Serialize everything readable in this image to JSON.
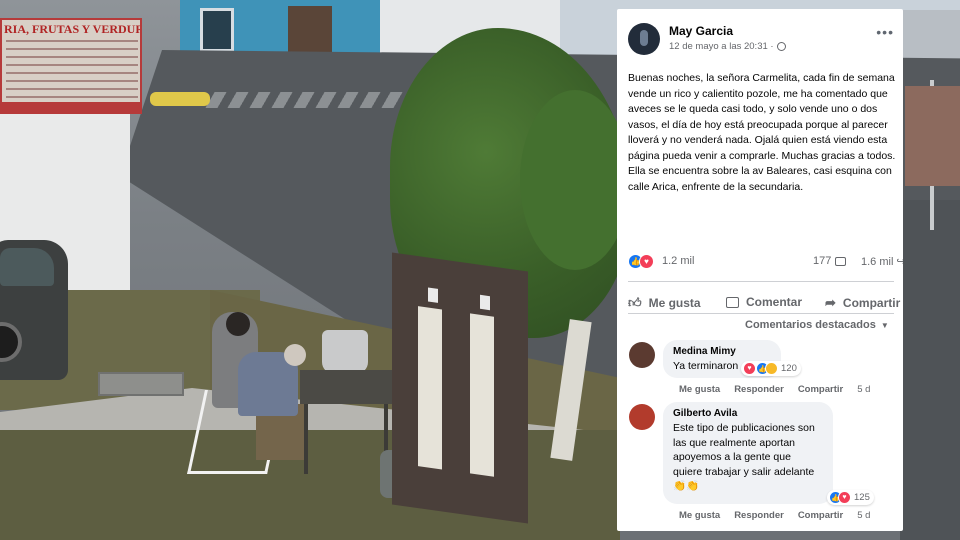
{
  "background": {
    "banner_title": "RIA, FRUTAS Y VERDURAS"
  },
  "post": {
    "author": "May Garcia",
    "date": "12 de mayo a las 20:31 ·",
    "privacy_icon": "globe-icon",
    "more_icon": "more-options-icon",
    "text": "Buenas noches, la señora Carmelita, cada fin de semana vende un rico y calientito pozole, me ha comentado que aveces se le queda casi todo, y solo vende uno o dos vasos, el día de hoy está preocupada porque al parecer lloverá y no venderá nada. Ojalá quien está viendo esta página pueda venir a comprarle. Muchas gracias a todos. Ella se encuentra sobre la av Baleares, casi esquina con calle Arica, enfrente de la secundaria.",
    "reactions_count": "1.2 mil",
    "comments_count": "177",
    "shares_count": "1.6 mil",
    "colors": {
      "like_blue": "#1877f2",
      "love_red": "#f33e58",
      "haha_yellow": "#f7b928",
      "meta_gray": "#65676b",
      "bubble_bg": "#f0f2f5"
    }
  },
  "actions": {
    "like": "Me gusta",
    "comment": "Comentar",
    "share": "Compartir"
  },
  "featured_label": "Comentarios destacados",
  "comments": [
    {
      "name": "Medina Mimy",
      "text": "Ya terminaron",
      "reaction_count": "120",
      "like": "Me gusta",
      "reply": "Responder",
      "share": "Compartir",
      "time": "5 d"
    },
    {
      "name": "Gilberto Avila",
      "text": "Este tipo de publicaciones son las que realmente aportan apoyemos a la gente que quiere trabajar y salir adelante 👏👏",
      "reaction_count": "125",
      "like": "Me gusta",
      "reply": "Responder",
      "share": "Compartir",
      "time": "5 d"
    }
  ]
}
